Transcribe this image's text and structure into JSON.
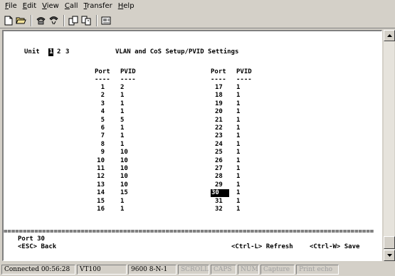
{
  "menubar": {
    "items": [
      {
        "accel": "F",
        "rest": "ile"
      },
      {
        "accel": "E",
        "rest": "dit"
      },
      {
        "accel": "V",
        "rest": "iew"
      },
      {
        "accel": "C",
        "rest": "all"
      },
      {
        "accel": "T",
        "rest": "ransfer"
      },
      {
        "accel": "H",
        "rest": "elp"
      }
    ]
  },
  "toolbar": {
    "buttons": [
      "new-document-icon",
      "open-folder-icon",
      "connect-phone-icon",
      "disconnect-icon",
      "send-file-icon",
      "receive-file-icon",
      "properties-icon"
    ]
  },
  "terminal": {
    "unit_label": "Unit",
    "units": [
      "1",
      "2",
      "3"
    ],
    "selected_unit": "1",
    "title": "VLAN and CoS Setup/PVID Settings",
    "col_port": "Port",
    "col_pvid": "PVID",
    "dashes": "----",
    "left_rows": [
      {
        "port": "1",
        "pvid": "2"
      },
      {
        "port": "2",
        "pvid": "1"
      },
      {
        "port": "3",
        "pvid": "1"
      },
      {
        "port": "4",
        "pvid": "1"
      },
      {
        "port": "5",
        "pvid": "5"
      },
      {
        "port": "6",
        "pvid": "1"
      },
      {
        "port": "7",
        "pvid": "1"
      },
      {
        "port": "8",
        "pvid": "1"
      },
      {
        "port": "9",
        "pvid": "10"
      },
      {
        "port": "10",
        "pvid": "10"
      },
      {
        "port": "11",
        "pvid": "10"
      },
      {
        "port": "12",
        "pvid": "10"
      },
      {
        "port": "13",
        "pvid": "10"
      },
      {
        "port": "14",
        "pvid": "15"
      },
      {
        "port": "15",
        "pvid": "1"
      },
      {
        "port": "16",
        "pvid": "1"
      }
    ],
    "right_rows": [
      {
        "port": "17",
        "pvid": "1"
      },
      {
        "port": "18",
        "pvid": "1"
      },
      {
        "port": "19",
        "pvid": "1"
      },
      {
        "port": "20",
        "pvid": "1"
      },
      {
        "port": "21",
        "pvid": "1"
      },
      {
        "port": "22",
        "pvid": "1"
      },
      {
        "port": "23",
        "pvid": "1"
      },
      {
        "port": "24",
        "pvid": "1"
      },
      {
        "port": "25",
        "pvid": "1"
      },
      {
        "port": "26",
        "pvid": "1"
      },
      {
        "port": "27",
        "pvid": "1"
      },
      {
        "port": "28",
        "pvid": "1"
      },
      {
        "port": "29",
        "pvid": "1"
      },
      {
        "port": "30",
        "pvid": "1"
      },
      {
        "port": "31",
        "pvid": "1"
      },
      {
        "port": "32",
        "pvid": "1"
      }
    ],
    "highlighted_port": "30",
    "separator": "================================================================================================",
    "status_line": "Port 30",
    "esc_back": "<ESC> Back",
    "ctrl_l": "<Ctrl-L> Refresh",
    "ctrl_w": "<Ctrl-W> Save"
  },
  "statusbar": {
    "connected": "Connected 00:56:28",
    "emulation": "VT100",
    "port_settings": "9600 8-N-1",
    "scroll": "SCROLL",
    "caps": "CAPS",
    "num": "NUM",
    "capture": "Capture",
    "print_echo": "Print echo"
  }
}
